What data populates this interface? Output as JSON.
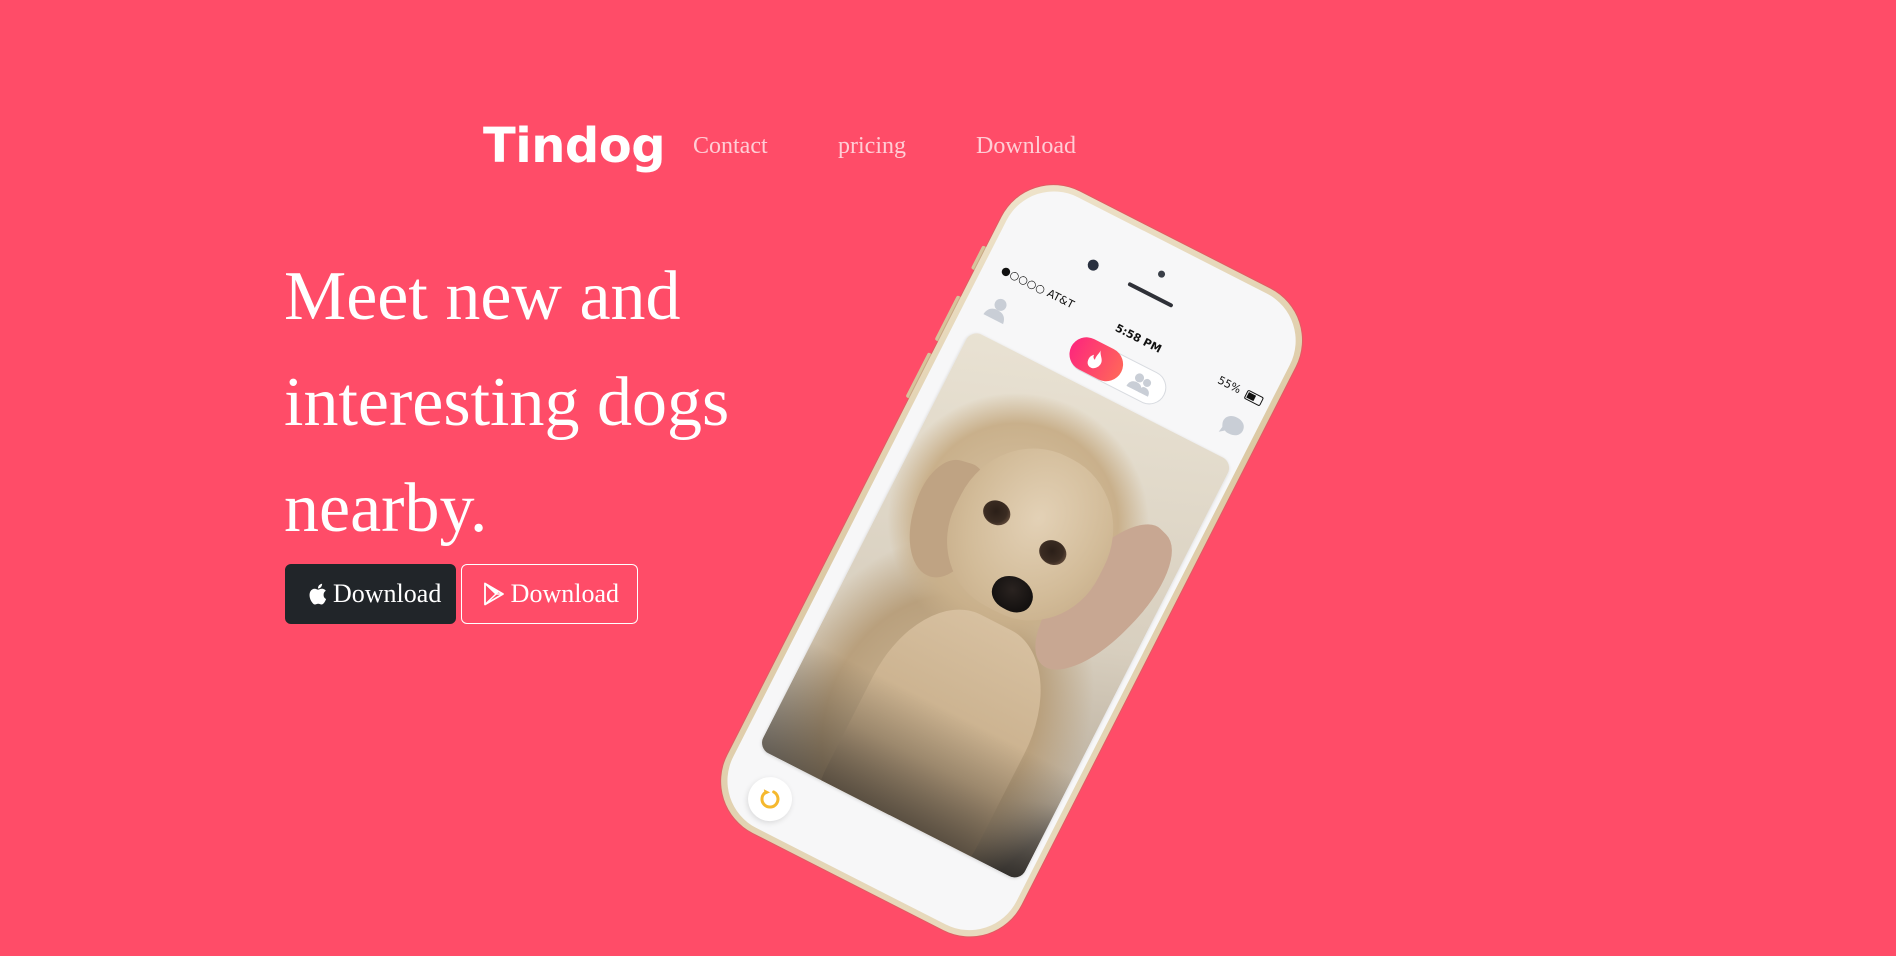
{
  "navbar": {
    "brand": "Tindog",
    "links": [
      {
        "label": "Contact"
      },
      {
        "label": "pricing"
      },
      {
        "label": "Download"
      }
    ]
  },
  "hero": {
    "title": "Meet new and interesting dogs nearby.",
    "buttons": [
      {
        "label": "Download",
        "icon": "apple-icon",
        "style": "dark"
      },
      {
        "label": "Download",
        "icon": "google-play-icon",
        "style": "outline-light"
      }
    ]
  },
  "phone": {
    "status": {
      "carrier": "●○○○○ AT&T",
      "time": "5:58 PM",
      "battery": "55%"
    },
    "icons": [
      "profile-icon",
      "flame-icon",
      "group-icon",
      "chat-icon",
      "rewind-icon"
    ]
  },
  "colors": {
    "background": "#ff4c68",
    "dark_button": "#212529",
    "text": "#ffffff",
    "toggle_gradient_start": "#fd297b",
    "toggle_gradient_end": "#ff655b"
  }
}
